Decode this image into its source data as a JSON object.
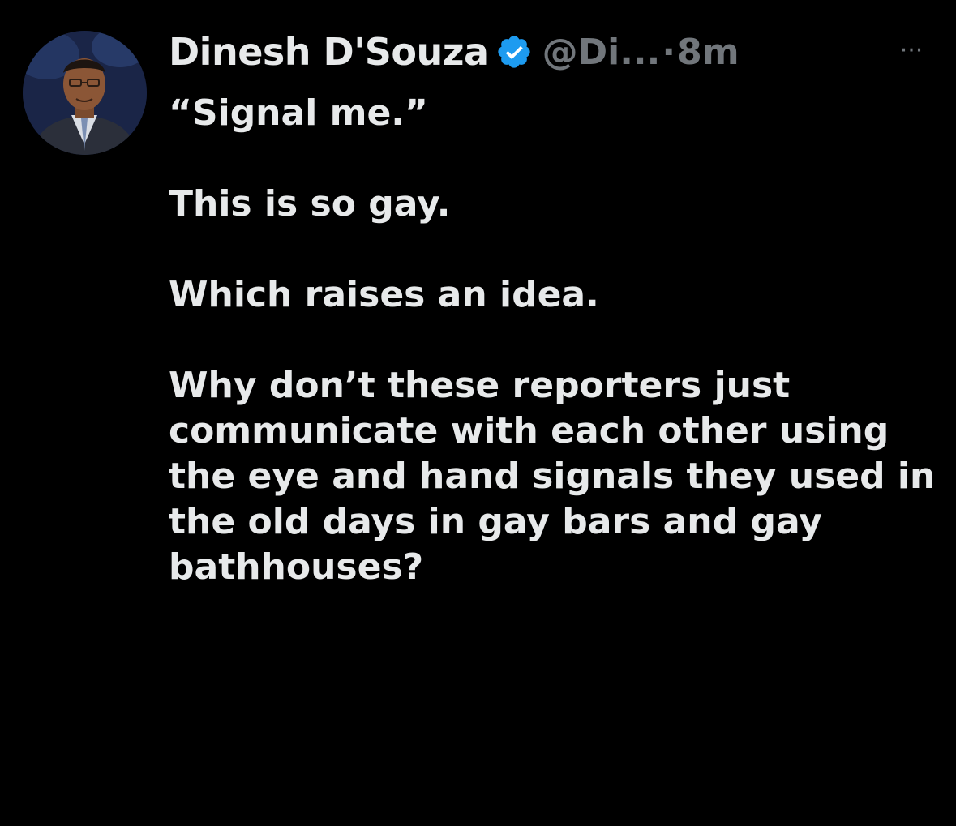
{
  "tweet": {
    "author_name": "Dinesh D'Souza",
    "handle": "@Di...",
    "separator": "·",
    "time": "8m",
    "more_label": "···",
    "verified_icon": "verified-badge-icon",
    "colors": {
      "background": "#000000",
      "text_primary": "#e7e9ea",
      "text_secondary": "#71767b",
      "verified": "#1d9bf0"
    },
    "paragraphs": [
      "“Signal me.”",
      "This is so gay.",
      "Which raises an idea.",
      "Why don’t these reporters just communicate with each other using the eye and hand signals they used in the old days in gay bars and gay bathhouses?"
    ]
  }
}
